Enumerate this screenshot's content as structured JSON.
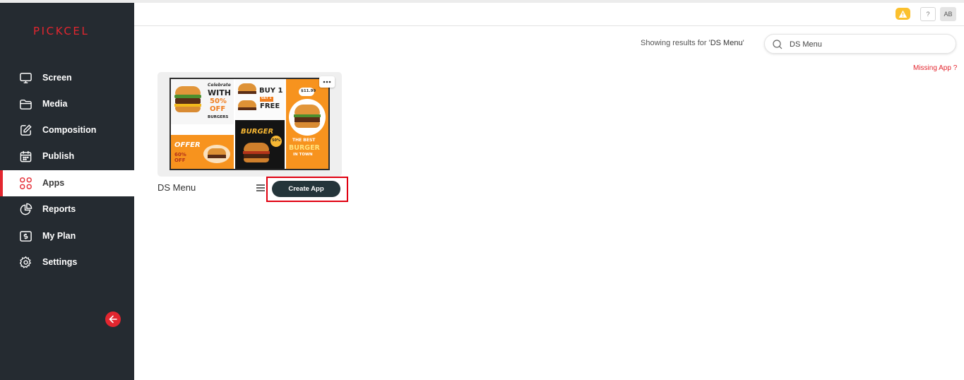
{
  "brand": {
    "logo_text": "PICKCEL",
    "accent_color": "#e3262f"
  },
  "sidebar": {
    "items": [
      {
        "label": "Screen",
        "icon": "monitor-icon"
      },
      {
        "label": "Media",
        "icon": "folder-icon"
      },
      {
        "label": "Composition",
        "icon": "edit-icon"
      },
      {
        "label": "Publish",
        "icon": "calendar-icon"
      },
      {
        "label": "Apps",
        "icon": "apps-grid-icon",
        "active": true
      },
      {
        "label": "Reports",
        "icon": "pie-chart-icon"
      },
      {
        "label": "My Plan",
        "icon": "dollar-card-icon"
      },
      {
        "label": "Settings",
        "icon": "gear-icon"
      }
    ],
    "collapse_icon": "arrow-left-icon"
  },
  "topbar": {
    "notification_icon": "bell-alert-icon",
    "help_label": "?",
    "avatar_initials": "AB"
  },
  "search": {
    "results_prefix": "Showing results for '",
    "results_query": "DS Menu",
    "results_suffix": "'",
    "value": "DS Menu",
    "placeholder": "Search"
  },
  "missing_app_label": "Missing App ?",
  "app_card": {
    "title": "DS Menu",
    "create_button_label": "Create App",
    "thumbnail_text": {
      "celebrate": "Celebrate",
      "with": "WITH",
      "fifty_off": "50%",
      "off": "OFF",
      "burgers": "BURGERS",
      "buy1": "BUY 1",
      "get1": "GET 1",
      "free": "FREE",
      "price": "$11.99",
      "offer": "OFFER",
      "offer_pct": "60%",
      "offer_off": "OFF",
      "burger": "BURGER",
      "badge_50": "50%",
      "the_best": "THE BEST",
      "burger2": "BURGER",
      "in_town": "IN TOWN"
    }
  }
}
